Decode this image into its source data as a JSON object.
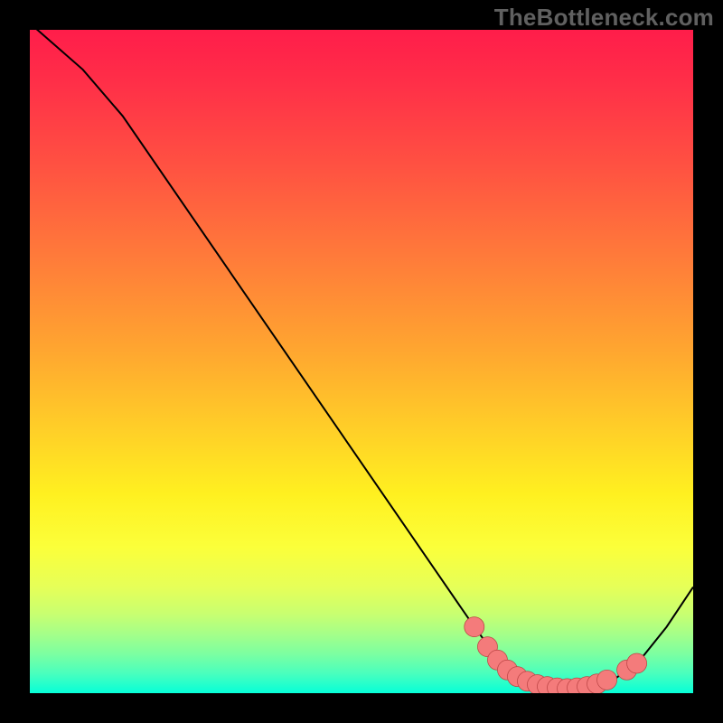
{
  "watermark": "TheBottleneck.com",
  "colors": {
    "curve_stroke": "#000000",
    "dot_fill": "#f47b7b",
    "dot_stroke": "#b44",
    "frame_bg": "#000000"
  },
  "chart_data": {
    "type": "line",
    "title": "",
    "xlabel": "",
    "ylabel": "",
    "xlim": [
      0,
      100
    ],
    "ylim": [
      0,
      100
    ],
    "curve": [
      {
        "x": 0,
        "y": 101
      },
      {
        "x": 8,
        "y": 94
      },
      {
        "x": 14,
        "y": 87
      },
      {
        "x": 67,
        "y": 10
      },
      {
        "x": 70,
        "y": 6
      },
      {
        "x": 73,
        "y": 3
      },
      {
        "x": 76,
        "y": 1.2
      },
      {
        "x": 80,
        "y": 0.6
      },
      {
        "x": 84,
        "y": 0.8
      },
      {
        "x": 88,
        "y": 2
      },
      {
        "x": 92,
        "y": 5
      },
      {
        "x": 96,
        "y": 10
      },
      {
        "x": 100,
        "y": 16
      }
    ],
    "dots": [
      {
        "x": 67,
        "y": 10
      },
      {
        "x": 69,
        "y": 7
      },
      {
        "x": 70.5,
        "y": 5
      },
      {
        "x": 72,
        "y": 3.5
      },
      {
        "x": 73.5,
        "y": 2.5
      },
      {
        "x": 75,
        "y": 1.8
      },
      {
        "x": 76.5,
        "y": 1.3
      },
      {
        "x": 78,
        "y": 1.0
      },
      {
        "x": 79.5,
        "y": 0.8
      },
      {
        "x": 81,
        "y": 0.7
      },
      {
        "x": 82.5,
        "y": 0.8
      },
      {
        "x": 84,
        "y": 1.0
      },
      {
        "x": 85.5,
        "y": 1.4
      },
      {
        "x": 87,
        "y": 2.0
      },
      {
        "x": 90,
        "y": 3.5
      },
      {
        "x": 91.5,
        "y": 4.5
      }
    ],
    "dot_radius": 1.5
  }
}
